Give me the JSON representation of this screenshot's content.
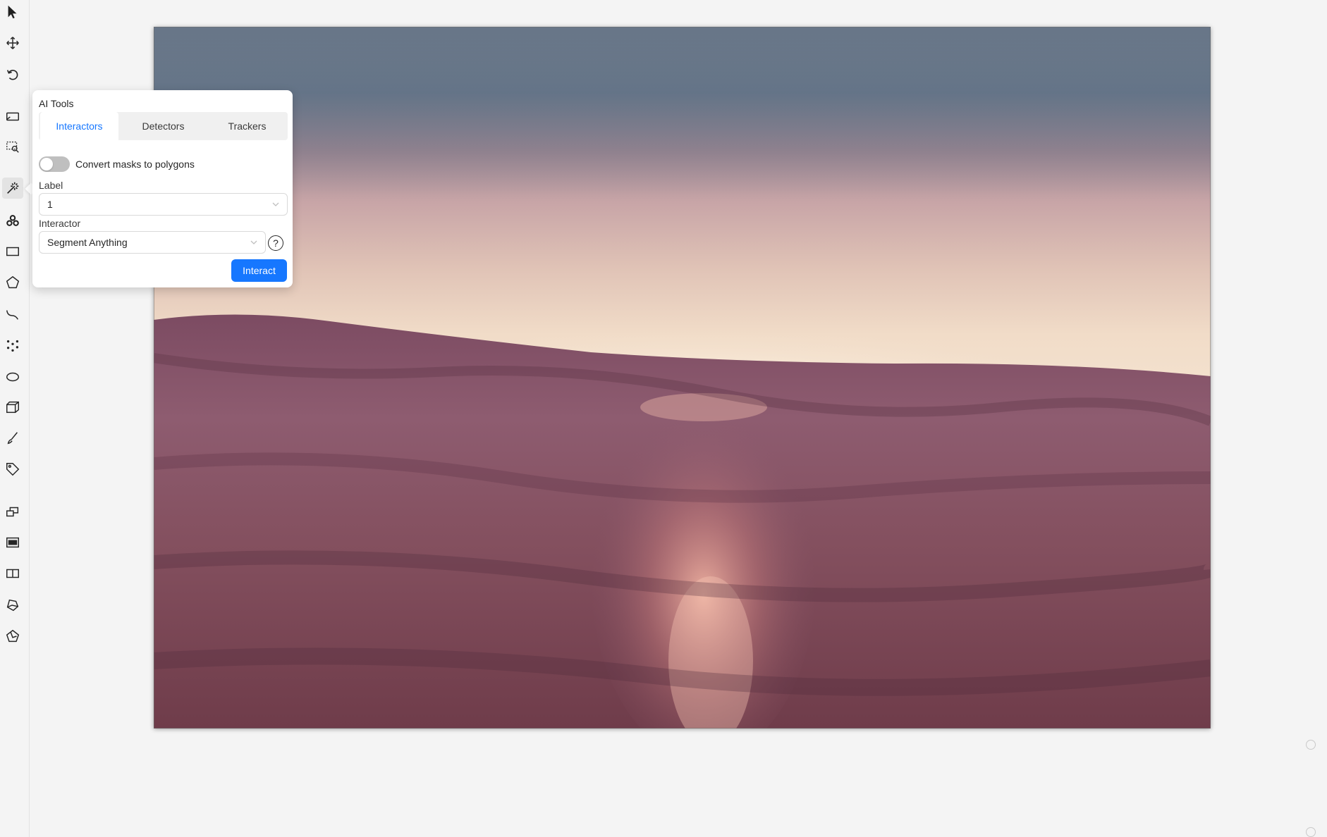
{
  "toolbar": {
    "tools": [
      {
        "name": "cursor-icon",
        "active": false
      },
      {
        "name": "move-icon",
        "active": false
      },
      {
        "name": "rotate-icon",
        "active": false
      },
      {
        "name": "fit-image-icon",
        "active": false
      },
      {
        "name": "zoom-region-icon",
        "active": false
      },
      {
        "name": "ai-tools-magic-wand-icon",
        "active": true
      },
      {
        "name": "openvino-icon",
        "active": false
      },
      {
        "name": "rectangle-icon",
        "active": false
      },
      {
        "name": "polygon-icon",
        "active": false
      },
      {
        "name": "polyline-icon",
        "active": false
      },
      {
        "name": "points-icon",
        "active": false
      },
      {
        "name": "ellipse-icon",
        "active": false
      },
      {
        "name": "cuboid-icon",
        "active": false
      },
      {
        "name": "brush-icon",
        "active": false
      },
      {
        "name": "tag-icon",
        "active": false
      },
      {
        "name": "merge-icon",
        "active": false
      },
      {
        "name": "group-icon",
        "active": false
      },
      {
        "name": "split-icon",
        "active": false
      },
      {
        "name": "join-icon",
        "active": false
      },
      {
        "name": "slice-icon",
        "active": false
      }
    ]
  },
  "ai_tools": {
    "title": "AI Tools",
    "tabs": [
      "Interactors",
      "Detectors",
      "Trackers"
    ],
    "active_tab": "Interactors",
    "convert_toggle_label": "Convert masks to polygons",
    "convert_toggle_on": false,
    "label_field_label": "Label",
    "label_value": "1",
    "interactor_field_label": "Interactor",
    "interactor_value": "Segment Anything",
    "help_symbol": "?",
    "interact_button": "Interact"
  },
  "colors": {
    "accent": "#1677ff",
    "background": "#f4f4f4"
  }
}
